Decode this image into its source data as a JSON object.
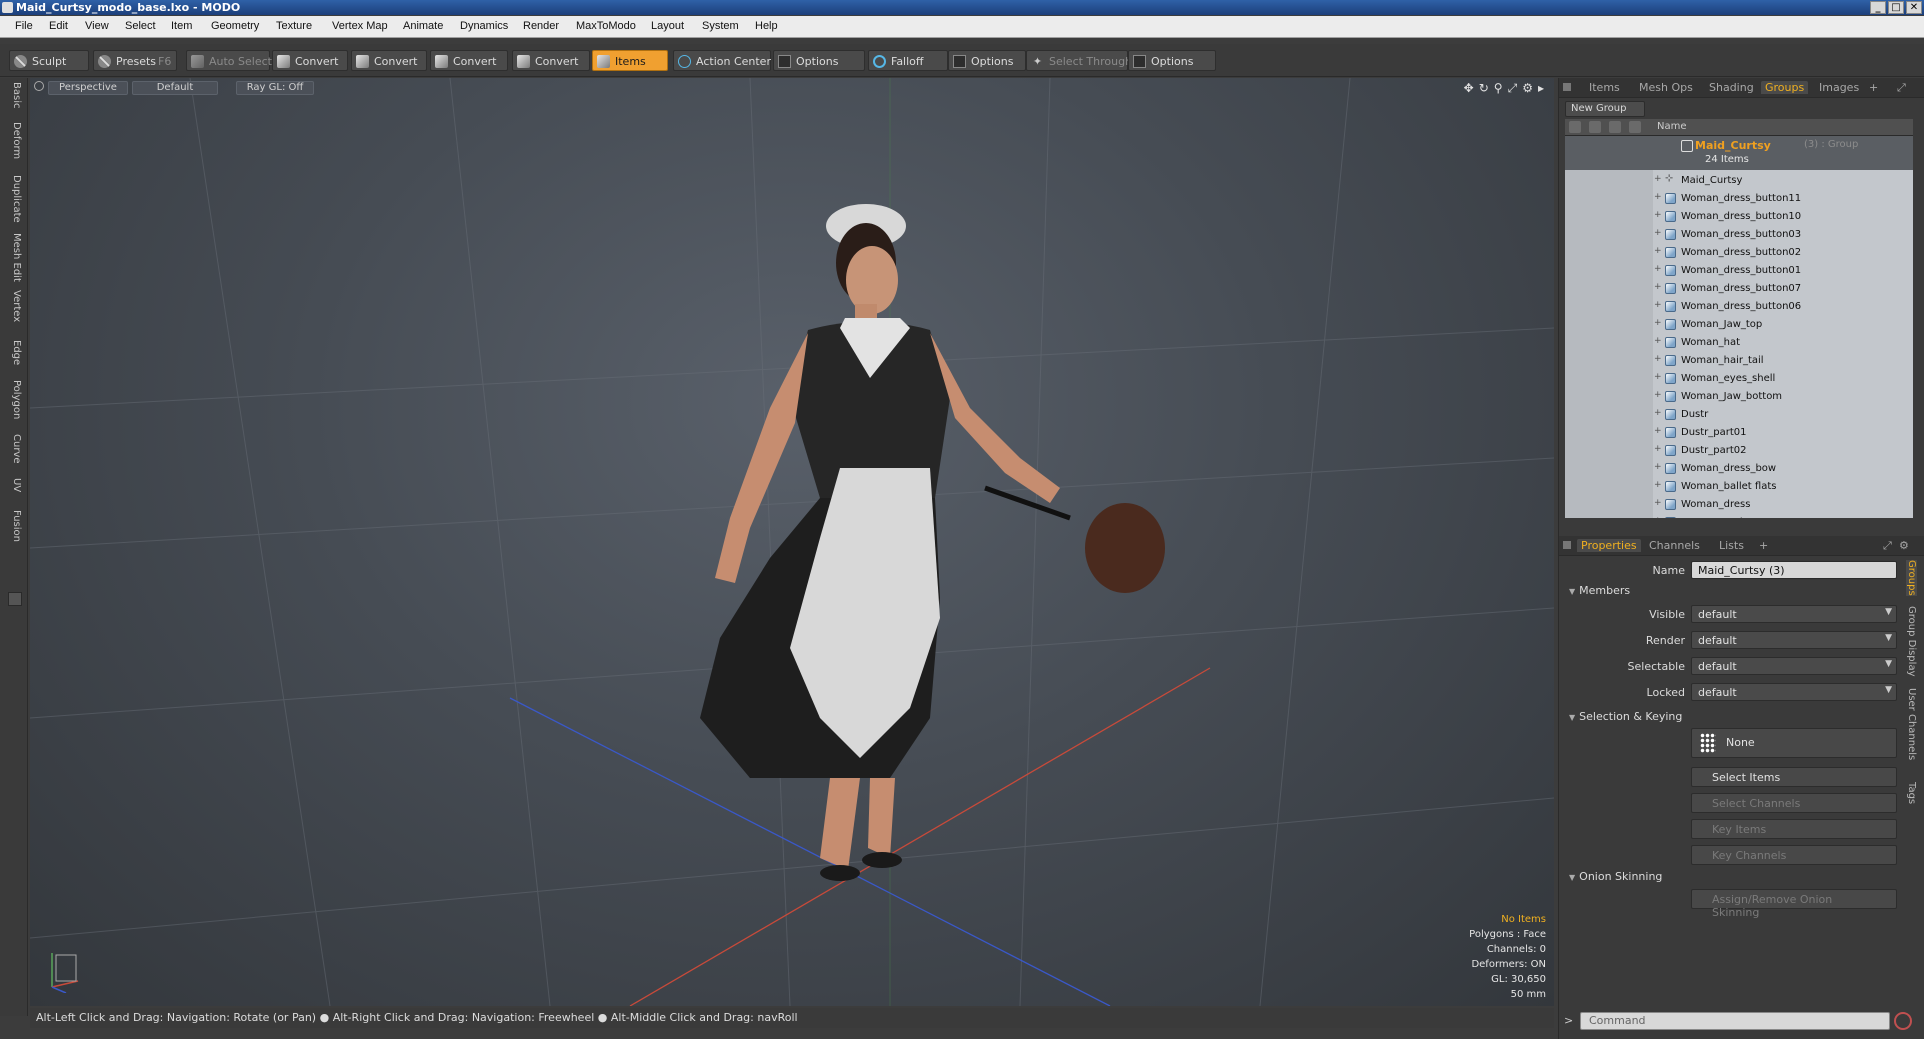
{
  "window": {
    "title": "Maid_Curtsy_modo_base.lxo - MODO",
    "buttons": [
      "_",
      "□",
      "✕"
    ]
  },
  "menu": [
    "File",
    "Edit",
    "View",
    "Select",
    "Item",
    "Geometry",
    "Texture",
    "Vertex Map",
    "Animate",
    "Dynamics",
    "Render",
    "MaxToModo",
    "Layout",
    "System",
    "Help"
  ],
  "toolbar": {
    "sculpt": "Sculpt",
    "presets": "Presets",
    "presets_key": "F6",
    "auto_select": "Auto Select",
    "convert1": "Convert",
    "convert2": "Convert",
    "convert3": "Convert",
    "convert4": "Convert",
    "items": "Items",
    "action_center": "Action Center",
    "options1": "Options",
    "falloff": "Falloff",
    "options2": "Options",
    "select_through": "Select Through",
    "options3": "Options"
  },
  "left_tabs": [
    "Basic",
    "Deform",
    "Duplicate",
    "Mesh Edit",
    "Vertex",
    "Edge",
    "Polygon",
    "Curve",
    "UV",
    "Fusion"
  ],
  "viewport": {
    "view": "Perspective",
    "shading": "Default",
    "raygl": "Ray GL: Off",
    "stats": {
      "items": "No Items",
      "polygons": "Polygons : Face",
      "channels": "Channels: 0",
      "deformers": "Deformers: ON",
      "gl": "GL: 30,650",
      "mm": "50 mm"
    }
  },
  "status": "Alt-Left Click and Drag: Navigation: Rotate (or Pan) ●  Alt-Right Click and Drag: Navigation: Freewheel ●  Alt-Middle Click and Drag: navRoll",
  "right_tabs_top": [
    "Items",
    "Mesh Ops",
    "Shading",
    "Groups",
    "Images"
  ],
  "active_top_tab": "Groups",
  "new_group": "New Group",
  "list_header": "Name",
  "group": {
    "name": "Maid_Curtsy",
    "suffix": "(3) : Group",
    "count": "24 Items"
  },
  "items": [
    {
      "name": "Maid_Curtsy",
      "type": "locator"
    },
    {
      "name": "Woman_dress_button11",
      "type": "mesh"
    },
    {
      "name": "Woman_dress_button10",
      "type": "mesh"
    },
    {
      "name": "Woman_dress_button03",
      "type": "mesh"
    },
    {
      "name": "Woman_dress_button02",
      "type": "mesh"
    },
    {
      "name": "Woman_dress_button01",
      "type": "mesh"
    },
    {
      "name": "Woman_dress_button07",
      "type": "mesh"
    },
    {
      "name": "Woman_dress_button06",
      "type": "mesh"
    },
    {
      "name": "Woman_Jaw_top",
      "type": "mesh"
    },
    {
      "name": "Woman_hat",
      "type": "mesh"
    },
    {
      "name": "Woman_hair_tail",
      "type": "mesh"
    },
    {
      "name": "Woman_eyes_shell",
      "type": "mesh"
    },
    {
      "name": "Woman_Jaw_bottom",
      "type": "mesh"
    },
    {
      "name": "Dustr",
      "type": "mesh"
    },
    {
      "name": "Dustr_part01",
      "type": "mesh"
    },
    {
      "name": "Dustr_part02",
      "type": "mesh"
    },
    {
      "name": "Woman_dress_bow",
      "type": "mesh"
    },
    {
      "name": "Woman_ballet flats",
      "type": "mesh"
    },
    {
      "name": "Woman_dress",
      "type": "mesh"
    },
    {
      "name": "Woman_underpants",
      "type": "mesh"
    }
  ],
  "prop_tabs": [
    "Properties",
    "Channels",
    "Lists"
  ],
  "properties": {
    "name_label": "Name",
    "name_value": "Maid_Curtsy (3)",
    "members": "Members",
    "visible_label": "Visible",
    "visible_value": "default",
    "render_label": "Render",
    "render_value": "default",
    "selectable_label": "Selectable",
    "selectable_value": "default",
    "locked_label": "Locked",
    "locked_value": "default",
    "selection_keying": "Selection & Keying",
    "none": "None",
    "select_items": "Select Items",
    "select_channels": "Select Channels",
    "key_items": "Key Items",
    "key_channels": "Key Channels",
    "onion_skinning": "Onion Skinning",
    "assign_onion": "Assign/Remove Onion Skinning"
  },
  "side_tabs": [
    "Groups",
    "Group Display",
    "User Channels",
    "Tags"
  ],
  "command_placeholder": "Command",
  "colors": {
    "accent": "#f0a030",
    "group_name": "#f0a020",
    "falloff": "#56b7e6"
  }
}
